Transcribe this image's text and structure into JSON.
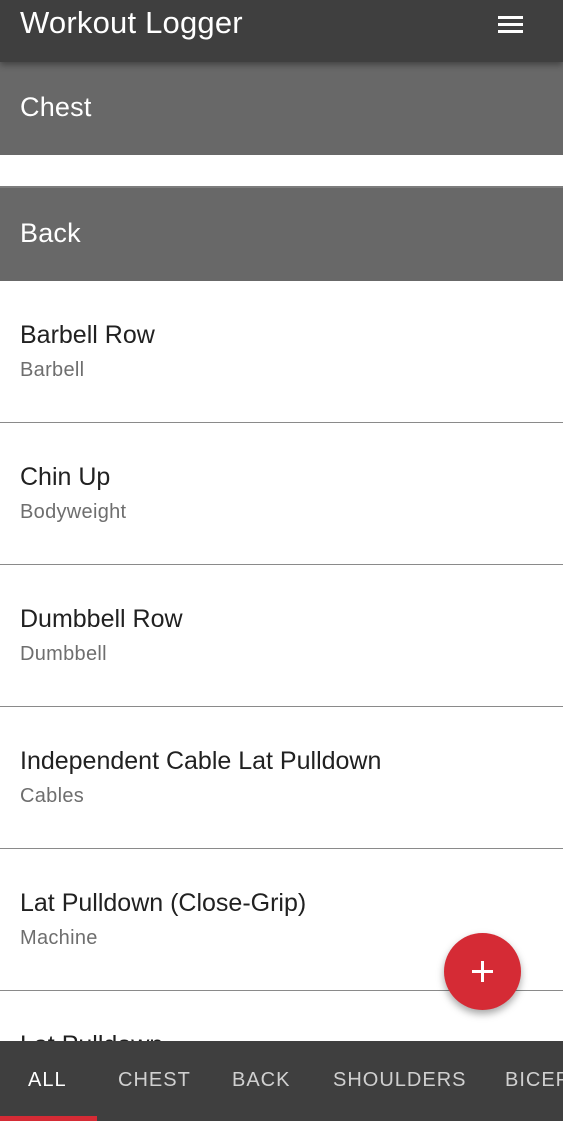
{
  "app": {
    "title": "Workout Logger"
  },
  "icons": {
    "menu": "hamburger-menu-icon",
    "fab": "plus-icon"
  },
  "colors": {
    "app_bar": "#3f3f3f",
    "section_header": "#686868",
    "accent": "#d52b35"
  },
  "sections": {
    "chest": {
      "label": "Chest"
    },
    "back": {
      "label": "Back"
    }
  },
  "exercises": [
    {
      "name": "Barbell Row",
      "equipment": "Barbell"
    },
    {
      "name": "Chin Up",
      "equipment": "Bodyweight"
    },
    {
      "name": "Dumbbell Row",
      "equipment": "Dumbbell"
    },
    {
      "name": "Independent Cable Lat Pulldown",
      "equipment": "Cables"
    },
    {
      "name": "Lat Pulldown (Close-Grip)",
      "equipment": "Machine"
    },
    {
      "name": "Lat Pulldown",
      "equipment": ""
    }
  ],
  "tabs": [
    {
      "label": "ALL",
      "active": true
    },
    {
      "label": "CHEST",
      "active": false
    },
    {
      "label": "BACK",
      "active": false
    },
    {
      "label": "SHOULDERS",
      "active": false
    },
    {
      "label": "BICEPS",
      "active": false
    }
  ]
}
